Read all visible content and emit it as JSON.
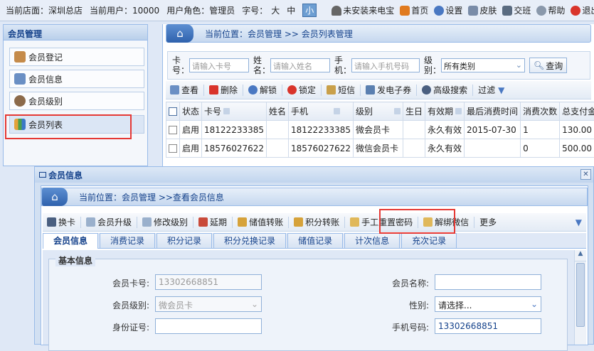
{
  "topbar": {
    "store": "当前店面：深圳总店",
    "user": "当前用户：10000",
    "role": "用户角色：管理员",
    "font_label": "字号：",
    "font_sizes": [
      "大",
      "中",
      "小"
    ],
    "links": [
      "未安装来电宝",
      "首页",
      "设置",
      "皮肤",
      "交班",
      "帮助",
      "退出"
    ]
  },
  "sidebar": {
    "title": "会员管理",
    "items": [
      "会员登记",
      "会员信息",
      "会员级别",
      "会员列表"
    ]
  },
  "main": {
    "breadcrumb": "当前位置：会员管理 >> 会员列表管理",
    "search": {
      "labels": [
        "卡号：",
        "姓名：",
        "手机：",
        "级别："
      ],
      "placeholders": [
        "请输入卡号",
        "请输入姓名",
        "请输入手机号码"
      ],
      "level_value": "所有类别",
      "query_button": "查询"
    },
    "toolbar": [
      "查看",
      "删除",
      "解锁",
      "锁定",
      "短信",
      "发电子券",
      "高级搜索",
      "过滤"
    ],
    "table": {
      "headers": [
        "状态",
        "卡号",
        "姓名",
        "手机",
        "级别",
        "生日",
        "有效期",
        "最后消费时间",
        "消费次数",
        "总支付金"
      ],
      "rows": [
        [
          "启用",
          "18122233385",
          "",
          "18122233385",
          "微会员卡",
          "",
          "永久有效",
          "2015-07-30",
          "1",
          "130.00"
        ],
        [
          "启用",
          "18576027622",
          "",
          "18576027622",
          "微信会员卡",
          "",
          "永久有效",
          "",
          "0",
          "500.00"
        ]
      ]
    }
  },
  "dialog": {
    "title": "会员信息",
    "breadcrumb": "当前位置：会员管理 >>查看会员信息",
    "toolbar": [
      "换卡",
      "会员升级",
      "修改级别",
      "延期",
      "储值转账",
      "积分转账",
      "手工重置密码",
      "解绑微信",
      "更多"
    ],
    "tabs": [
      "会员信息",
      "消费记录",
      "积分记录",
      "积分兑换记录",
      "储值记录",
      "计次信息",
      "充次记录"
    ],
    "section_title": "基本信息",
    "fields": {
      "card_no_label": "会员卡号:",
      "card_no_value": "13302668851",
      "name_label": "会员名称:",
      "name_value": "",
      "level_label": "会员级别:",
      "level_value": "微会员卡",
      "gender_label": "性别:",
      "gender_value": "请选择...",
      "id_label": "身份证号:",
      "id_value": "",
      "phone_label": "手机号码:",
      "phone_value": "13302668851"
    }
  },
  "colors": {
    "highlight": "#e53935",
    "accent": "#15428b"
  }
}
